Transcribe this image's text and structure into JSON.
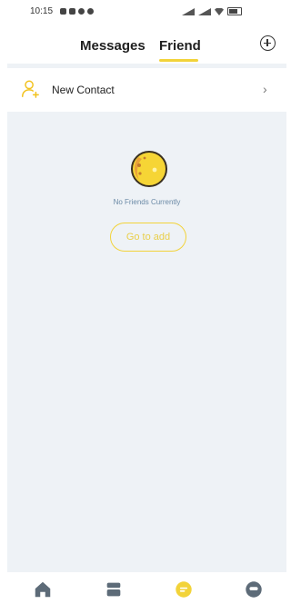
{
  "status_bar": {
    "time": "10:15"
  },
  "header": {
    "tabs": [
      {
        "label": "Messages",
        "active": false
      },
      {
        "label": "Friend",
        "active": true
      }
    ]
  },
  "new_contact": {
    "label": "New Contact"
  },
  "empty_state": {
    "message": "No Friends Currently",
    "button_label": "Go to add"
  },
  "bottom_nav": {
    "items": [
      {
        "icon": "home-icon",
        "active": false
      },
      {
        "icon": "store-icon",
        "active": false
      },
      {
        "icon": "chat-icon",
        "active": true
      },
      {
        "icon": "profile-icon",
        "active": false
      }
    ]
  },
  "colors": {
    "accent": "#f2d33a",
    "background": "#eef2f6",
    "inactive_icon": "#5d6b78"
  }
}
